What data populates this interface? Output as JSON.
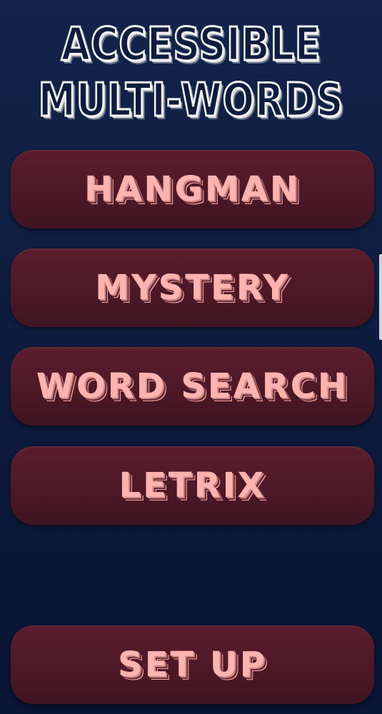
{
  "app": {
    "title_line1": "ACCESSIBLE",
    "title_line2": "MULTI-WORDS"
  },
  "menu": {
    "items": [
      {
        "label": "HANGMAN"
      },
      {
        "label": "MYSTERY"
      },
      {
        "label": "WORD SEARCH"
      },
      {
        "label": "LETRIX"
      }
    ],
    "setup_label": "SET UP"
  },
  "colors": {
    "background": "#0f1c3f",
    "button": "#4d1827",
    "button_text": "#ffb3b0",
    "title_text": "#f4f4f4"
  }
}
